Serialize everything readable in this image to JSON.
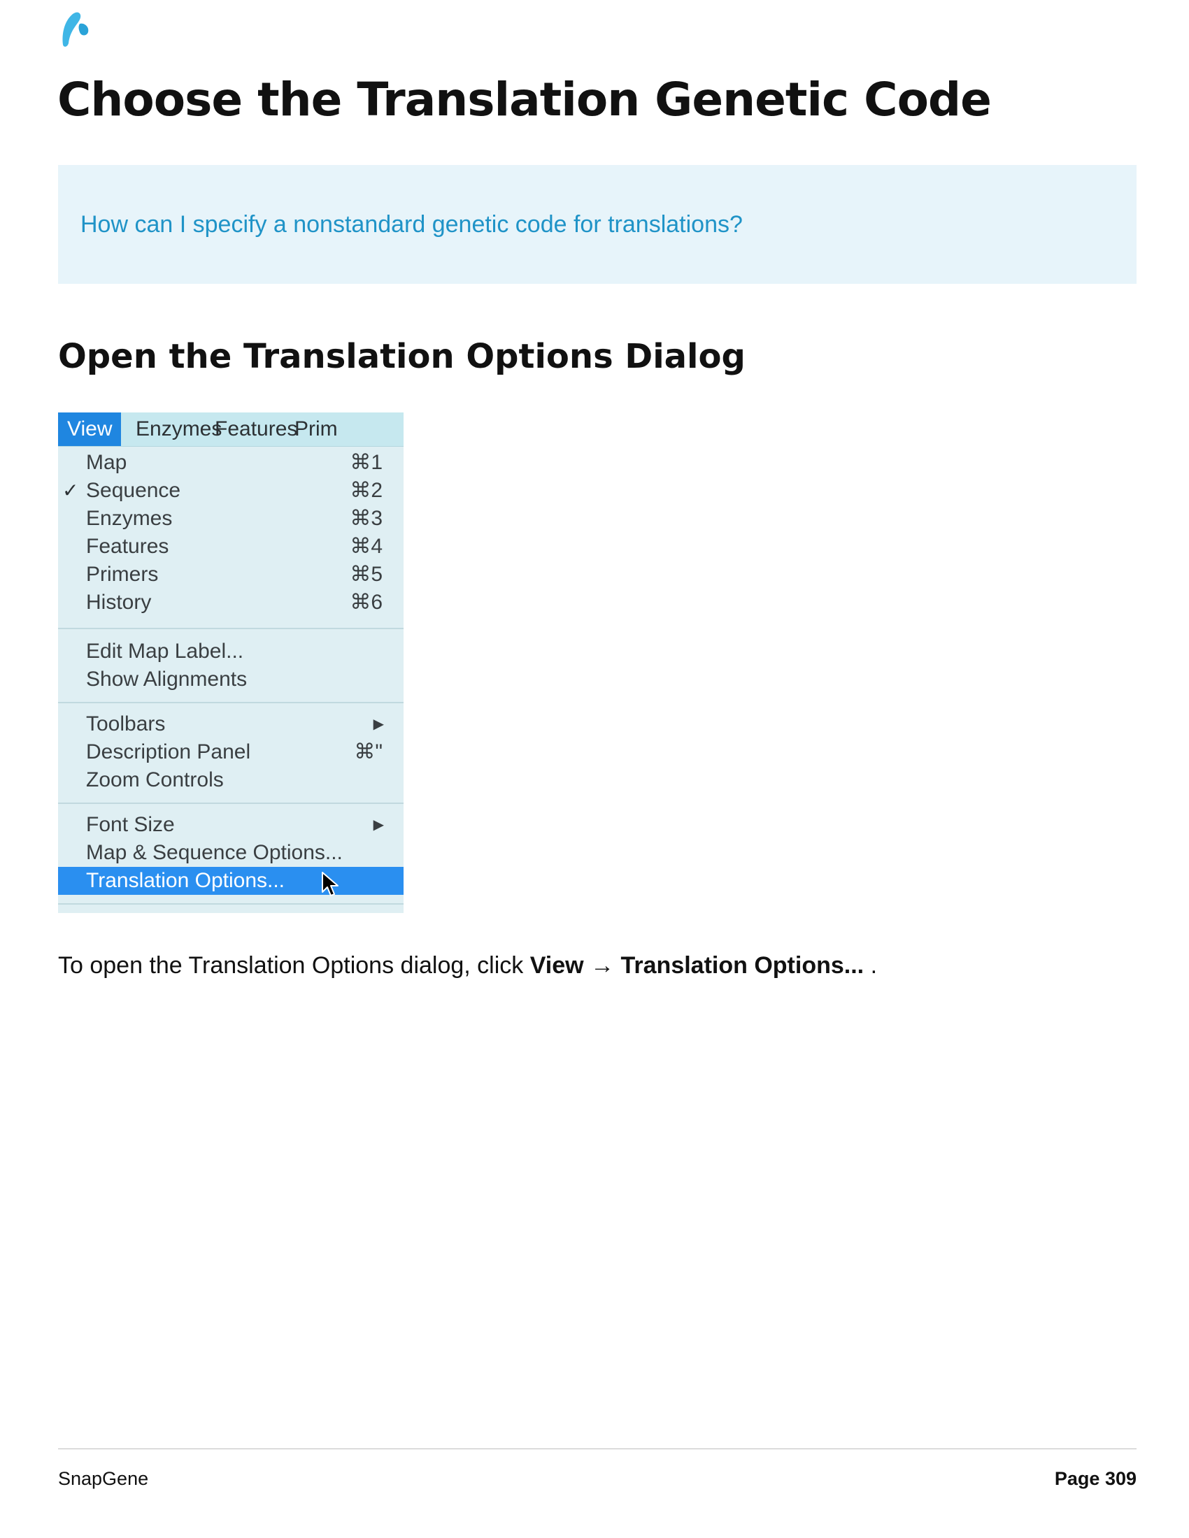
{
  "page": {
    "title": "Choose the Translation Genetic Code",
    "callout": "How can I specify a nonstandard genetic code for translations?",
    "section_heading": "Open the Translation Options Dialog",
    "instruction": {
      "prefix": "To open the Translation Options dialog, click",
      "menu": "View",
      "arrow": "→",
      "item": "Translation Options...",
      "suffix": "."
    },
    "footer": {
      "brand": "SnapGene",
      "page_label": "Page 309"
    },
    "colors": {
      "callout_bg": "#e7f4fa",
      "callout_text": "#1f93c7",
      "menu_highlight": "#2a8ff0"
    }
  },
  "menu": {
    "bar": [
      "View",
      "Enzymes",
      "Features",
      "Prim"
    ],
    "check_glyph": "✓",
    "items": [
      {
        "label": "Map",
        "shortcut": "⌘1"
      },
      {
        "label": "Sequence",
        "shortcut": "⌘2",
        "checked": true
      },
      {
        "label": "Enzymes",
        "shortcut": "⌘3"
      },
      {
        "label": "Features",
        "shortcut": "⌘4"
      },
      {
        "label": "Primers",
        "shortcut": "⌘5"
      },
      {
        "label": "History",
        "shortcut": "⌘6"
      },
      {
        "label": "Edit Map Label..."
      },
      {
        "label": "Show Alignments"
      },
      {
        "label": "Toolbars",
        "submenu": "▶"
      },
      {
        "label": "Description Panel",
        "shortcut": "⌘\""
      },
      {
        "label": "Zoom Controls"
      },
      {
        "label": "Font Size",
        "submenu": "▶"
      },
      {
        "label": "Map & Sequence Options..."
      },
      {
        "label": "Translation Options...",
        "highlighted": true
      }
    ]
  }
}
